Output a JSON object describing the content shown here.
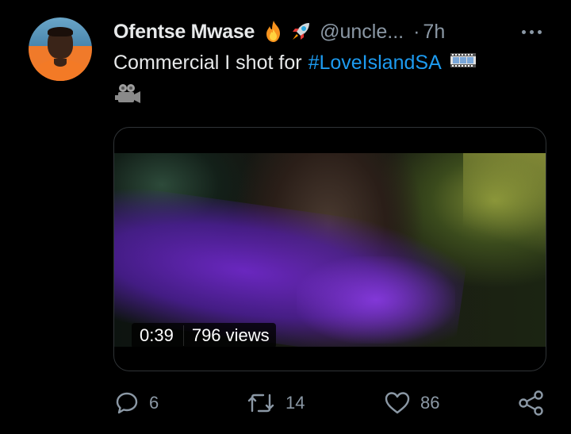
{
  "tweet": {
    "author_name": "Ofentse Mwase",
    "emojis": [
      "fire-emoji",
      "rocket-emoji"
    ],
    "handle": "@uncle...",
    "separator": "·",
    "time": "7h",
    "text_prefix": "Commercial I shot for",
    "hashtag": "#LoveIslandSA",
    "trailing_emojis": [
      "film-strip-emoji",
      "movie-camera-emoji"
    ]
  },
  "media": {
    "duration": "0:39",
    "views": "796 views"
  },
  "actions": {
    "reply_count": "6",
    "retweet_count": "14",
    "like_count": "86"
  },
  "colors": {
    "background": "#000000",
    "text": "#e7e9ea",
    "secondary": "#8b98a5",
    "link": "#1d9bf0"
  }
}
